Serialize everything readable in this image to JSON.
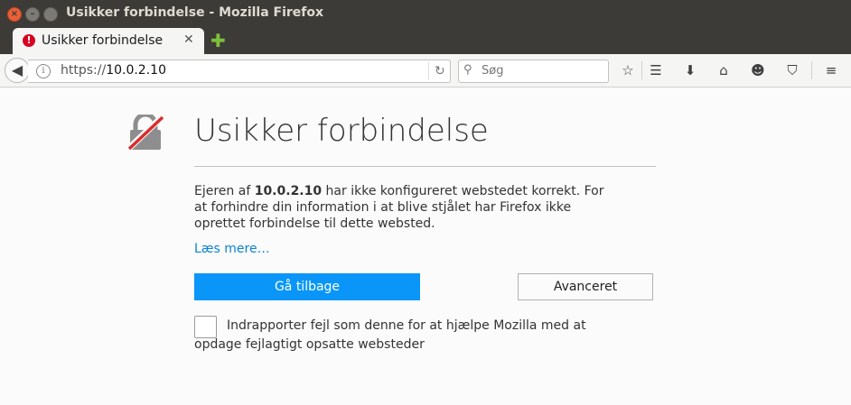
{
  "window": {
    "title": "Usikker forbindelse - Mozilla Firefox"
  },
  "tab": {
    "label": "Usikker forbindelse"
  },
  "navbar": {
    "url_scheme": "https://",
    "url_host": "10.0.2.10",
    "search_placeholder": "Søg"
  },
  "error_page": {
    "heading": "Usikker forbindelse",
    "desc_prefix": "Ejeren af ",
    "desc_host": "10.0.2.10",
    "desc_suffix": " har ikke konfigureret webstedet korrekt. For at forhindre din information i at blive stjålet har Firefox ikke oprettet forbindelse til dette websted.",
    "learn_more": "Læs mere…",
    "back_button": "Gå tilbage",
    "advanced_button": "Avanceret",
    "report_text": "Indrapporter fejl som denne for at hjælpe Mozilla med at opdage fejlagtigt opsatte websteder"
  }
}
